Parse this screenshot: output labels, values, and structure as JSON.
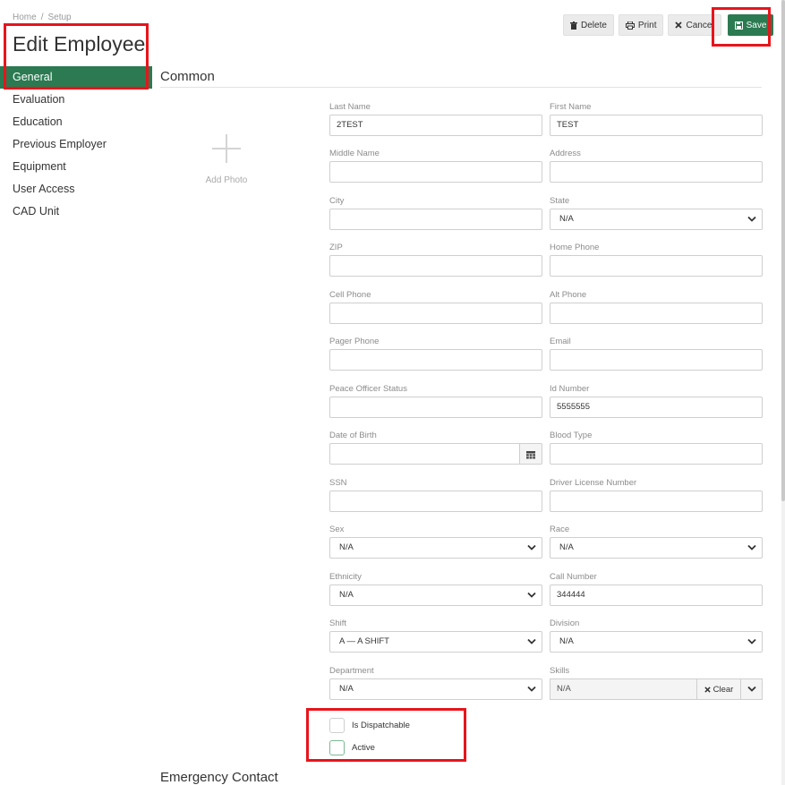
{
  "breadcrumb": {
    "home": "Home",
    "sep": "/",
    "current": "Setup"
  },
  "page": {
    "title": "Edit Employee"
  },
  "sidebar": {
    "items": [
      {
        "label": "General",
        "active": true
      },
      {
        "label": "Evaluation"
      },
      {
        "label": "Education"
      },
      {
        "label": "Previous Employer"
      },
      {
        "label": "Equipment"
      },
      {
        "label": "User Access"
      },
      {
        "label": "CAD Unit"
      }
    ]
  },
  "toolbar": {
    "delete_label": "Delete",
    "print_label": "Print",
    "cancel_label": "Cancel",
    "save_label": "Save"
  },
  "photo": {
    "label": "Add Photo"
  },
  "sections": {
    "common": "Common",
    "emergency": "Emergency Contact"
  },
  "form": {
    "last_name": {
      "label": "Last Name",
      "value": "2TEST"
    },
    "first_name": {
      "label": "First Name",
      "value": "TEST"
    },
    "middle_name": {
      "label": "Middle Name",
      "value": ""
    },
    "address": {
      "label": "Address",
      "value": ""
    },
    "city": {
      "label": "City",
      "value": ""
    },
    "state": {
      "label": "State",
      "value": "N/A"
    },
    "zip": {
      "label": "ZIP",
      "value": ""
    },
    "home_phone": {
      "label": "Home Phone",
      "value": ""
    },
    "cell_phone": {
      "label": "Cell Phone",
      "value": ""
    },
    "alt_phone": {
      "label": "Alt Phone",
      "value": ""
    },
    "pager_phone": {
      "label": "Pager Phone",
      "value": ""
    },
    "email": {
      "label": "Email",
      "value": ""
    },
    "peace_officer_status": {
      "label": "Peace Officer Status",
      "value": ""
    },
    "id_number": {
      "label": "Id Number",
      "value": "5555555"
    },
    "date_of_birth": {
      "label": "Date of Birth",
      "value": ""
    },
    "blood_type": {
      "label": "Blood Type",
      "value": ""
    },
    "ssn": {
      "label": "SSN",
      "value": ""
    },
    "driver_license": {
      "label": "Driver License Number",
      "value": ""
    },
    "sex": {
      "label": "Sex",
      "value": "N/A"
    },
    "race": {
      "label": "Race",
      "value": "N/A"
    },
    "ethnicity": {
      "label": "Ethnicity",
      "value": "N/A"
    },
    "call_number": {
      "label": "Call Number",
      "value": "344444"
    },
    "shift": {
      "label": "Shift",
      "value": "A — A SHIFT"
    },
    "division": {
      "label": "Division",
      "value": "N/A"
    },
    "department": {
      "label": "Department",
      "value": "N/A"
    },
    "skills": {
      "label": "Skills",
      "value": "N/A",
      "clear_label": "Clear"
    }
  },
  "checkboxes": {
    "is_dispatchable": {
      "label": "Is Dispatchable",
      "checked": false
    },
    "active": {
      "label": "Active",
      "checked": false
    }
  },
  "colors": {
    "accent": "#2b7a51",
    "highlight": "#e8141b"
  }
}
